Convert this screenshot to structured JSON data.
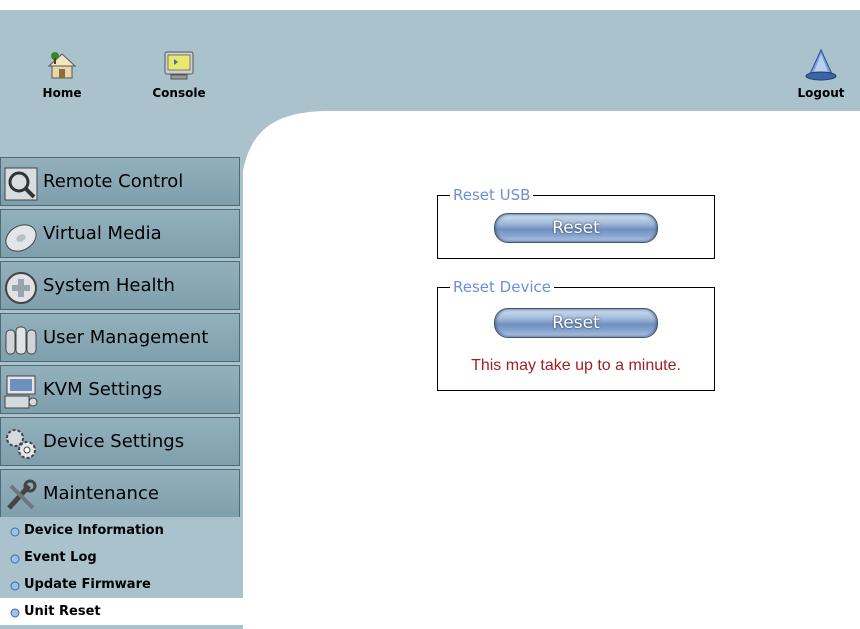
{
  "header": {
    "home_label": "Home",
    "console_label": "Console",
    "logout_label": "Logout"
  },
  "sidebar": {
    "items": [
      {
        "label": "Remote Control",
        "icon": "remote-control-icon"
      },
      {
        "label": "Virtual Media",
        "icon": "virtual-media-icon"
      },
      {
        "label": "System Health",
        "icon": "system-health-icon"
      },
      {
        "label": "User Management",
        "icon": "user-management-icon"
      },
      {
        "label": "KVM Settings",
        "icon": "kvm-settings-icon"
      },
      {
        "label": "Device Settings",
        "icon": "device-settings-icon"
      },
      {
        "label": "Maintenance",
        "icon": "maintenance-icon"
      }
    ],
    "subitems": [
      {
        "label": "Device Information",
        "active": false
      },
      {
        "label": "Event Log",
        "active": false
      },
      {
        "label": "Update Firmware",
        "active": false
      },
      {
        "label": "Unit Reset",
        "active": true
      }
    ]
  },
  "main": {
    "reset_usb": {
      "title": "Reset USB",
      "button_label": "Reset"
    },
    "reset_device": {
      "title": "Reset Device",
      "button_label": "Reset",
      "note": "This may take up to a minute."
    }
  },
  "colors": {
    "header_bg": "#a9c2cc",
    "legend_text": "#6d8fd8",
    "warning_text": "#a31f1f"
  }
}
